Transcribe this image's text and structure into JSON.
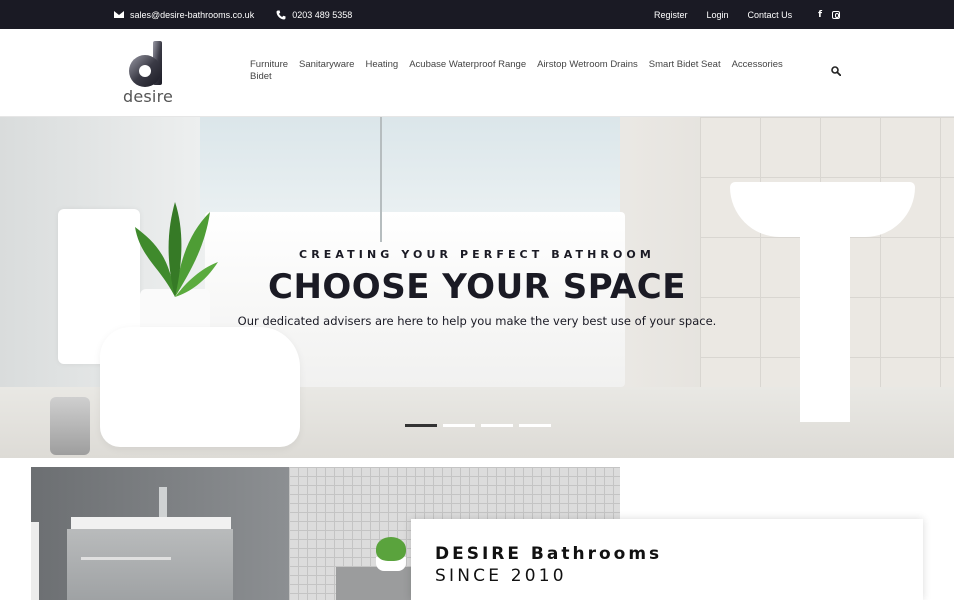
{
  "topbar": {
    "email": "sales@desire-bathrooms.co.uk",
    "phone": "0203 489 5358",
    "links": [
      "Register",
      "Login",
      "Contact Us"
    ],
    "icons": [
      "envelope-icon",
      "phone-icon",
      "facebook-icon",
      "instagram-icon"
    ]
  },
  "header": {
    "logo_text": "desire",
    "nav": [
      "Furniture",
      "Sanitaryware",
      "Heating",
      "Acubase Waterproof Range",
      "Airstop Wetroom Drains",
      "Smart Bidet Seat",
      "Accessories",
      "Bidet"
    ],
    "search_icon": "search-icon"
  },
  "hero": {
    "kicker": "CREATING YOUR PERFECT BATHROOM",
    "title": "CHOOSE YOUR SPACE",
    "subtitle": "Our dedicated advisers are here to help you make the very best use of your space.",
    "slides_total": 4,
    "active_slide": 1
  },
  "about": {
    "title": "DESIRE Bathrooms",
    "subtitle": "SINCE 2010"
  },
  "colors": {
    "topbar_bg": "#1a1a24",
    "heading": "#1a1a24"
  }
}
